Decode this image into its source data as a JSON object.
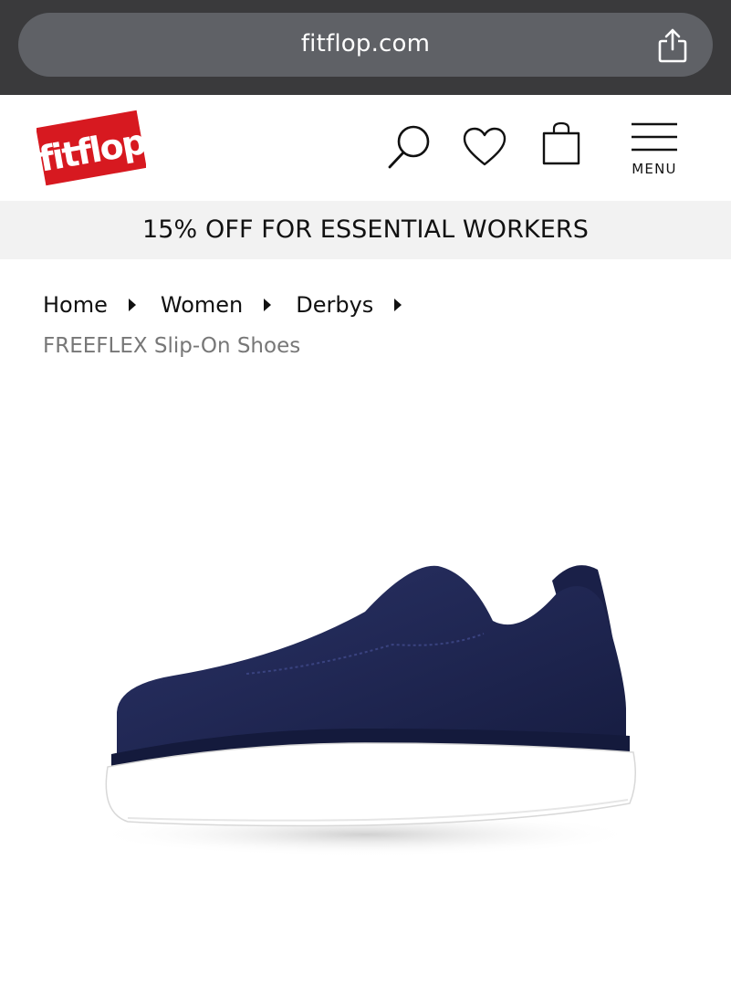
{
  "browser": {
    "url": "fitflop.com",
    "share_icon": "share-icon"
  },
  "header": {
    "logo_text": "fitflop",
    "brand_color": "#d71920",
    "icons": [
      "search-icon",
      "heart-icon",
      "bag-icon",
      "hamburger-icon"
    ],
    "menu_label": "MENU"
  },
  "promo": {
    "text": "15% OFF FOR ESSENTIAL WORKERS"
  },
  "breadcrumb": {
    "items": [
      "Home",
      "Women",
      "Derbys"
    ],
    "current": "FREEFLEX Slip-On Shoes"
  },
  "product": {
    "image": "navy-slip-on-shoe",
    "colors": {
      "upper": "#1d2550",
      "sole": "#ffffff"
    }
  }
}
